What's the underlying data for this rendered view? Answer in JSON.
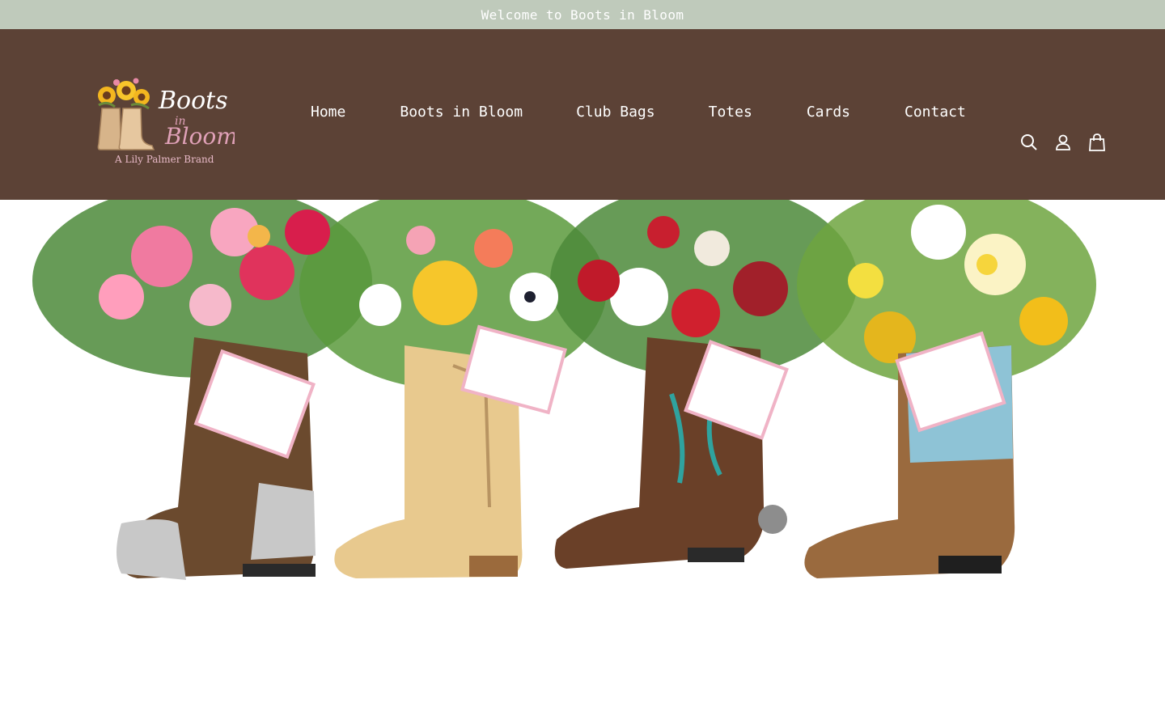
{
  "announcement": {
    "text": "Welcome to Boots in Bloom"
  },
  "header": {
    "logo": {
      "title_line1": "Boots",
      "title_line2": "in",
      "title_line3": "Bloom",
      "tagline": "A Lily Palmer Brand"
    },
    "nav": [
      {
        "label": "Home"
      },
      {
        "label": "Boots in Bloom"
      },
      {
        "label": "Club Bags"
      },
      {
        "label": "Totes"
      },
      {
        "label": "Cards"
      },
      {
        "label": "Contact"
      }
    ],
    "icons": [
      "search-icon",
      "account-icon",
      "cart-icon"
    ]
  },
  "hero": {
    "products": [
      {
        "name": "brown-silver-boot",
        "boot_color": "#6b4a2e",
        "tip_color": "#c8c8c8"
      },
      {
        "name": "tan-boot",
        "boot_color": "#e8c98e",
        "tip_color": "#e8c98e"
      },
      {
        "name": "turquoise-stitched-boot",
        "boot_color": "#6a4028",
        "tip_color": "#4e3020"
      },
      {
        "name": "blue-top-boot",
        "boot_color": "#9a6a3e",
        "tip_color": "#9a6a3e"
      }
    ]
  },
  "colors": {
    "announcement_bg": "#bfcabb",
    "header_bg": "#5c4236",
    "logo_pink": "#e0a1b8"
  }
}
